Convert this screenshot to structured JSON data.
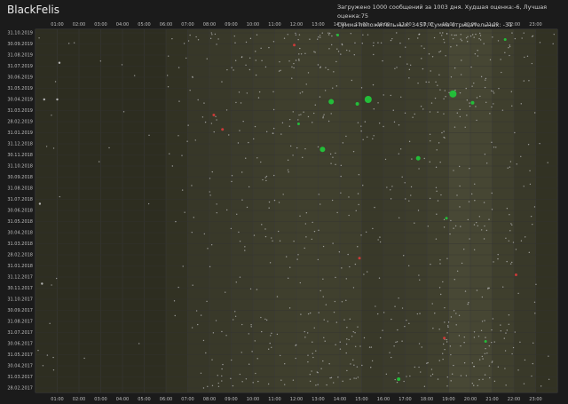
{
  "user": {
    "name": "BlackFelis"
  },
  "stats": {
    "line1": "Загружено 1000 сообщений за 1003 дня. Худшая оценка:-6, Лучшая оценка:75",
    "line2": "Сумма положительных: 3457, Сумма отрицательных: -31"
  },
  "colors": {
    "background": "#1b1b1b",
    "neutral": "#bdbdbd",
    "positive": "#22c43a",
    "negative": "#d23a3a"
  },
  "chart_data": {
    "type": "scatter",
    "title": "",
    "xlabel": "",
    "ylabel": "",
    "x_ticks": [
      "01:00",
      "02:00",
      "03:00",
      "04:00",
      "05:00",
      "06:00",
      "07:00",
      "08:00",
      "09:00",
      "10:00",
      "11:00",
      "12:00",
      "13:00",
      "14:00",
      "15:00",
      "16:00",
      "17:00",
      "18:00",
      "19:00",
      "20:00",
      "21:00",
      "22:00",
      "23:00"
    ],
    "y_ticks": [
      "31.10.2019",
      "30.09.2019",
      "31.08.2019",
      "31.07.2019",
      "30.06.2019",
      "31.05.2019",
      "30.04.2019",
      "31.03.2019",
      "28.02.2019",
      "31.01.2019",
      "31.12.2018",
      "30.11.2018",
      "31.10.2018",
      "30.09.2018",
      "31.08.2018",
      "31.07.2018",
      "30.06.2018",
      "31.05.2018",
      "30.04.2018",
      "31.03.2018",
      "28.02.2018",
      "31.01.2018",
      "31.12.2017",
      "30.11.2017",
      "31.10.2017",
      "30.09.2017",
      "31.08.2017",
      "31.07.2017",
      "30.06.2017",
      "31.05.2017",
      "30.04.2017",
      "31.03.2017",
      "28.02.2017"
    ],
    "xlim": [
      0,
      24
    ],
    "hour_activity": [
      0.05,
      0.03,
      0.02,
      0.02,
      0.02,
      0.03,
      0.15,
      0.3,
      0.35,
      0.4,
      0.45,
      0.5,
      0.55,
      0.55,
      0.5,
      0.35,
      0.4,
      0.45,
      0.55,
      0.75,
      0.7,
      0.5,
      0.35,
      0.15
    ],
    "points": [
      {
        "h": 13.6,
        "m": 6.2,
        "r": "pos",
        "s": 3
      },
      {
        "h": 15.3,
        "m": 6.0,
        "r": "pos",
        "s": 4
      },
      {
        "h": 19.2,
        "m": 5.5,
        "r": "pos",
        "s": 4
      },
      {
        "h": 13.2,
        "m": 10.5,
        "r": "pos",
        "s": 3
      },
      {
        "h": 17.6,
        "m": 11.3,
        "r": "pos",
        "s": 2.5
      },
      {
        "h": 14.8,
        "m": 6.4,
        "r": "pos",
        "s": 2
      },
      {
        "h": 20.1,
        "m": 6.3,
        "r": "pos",
        "s": 2
      },
      {
        "h": 12.1,
        "m": 8.2,
        "r": "pos",
        "s": 1.5
      },
      {
        "h": 16.7,
        "m": 31.2,
        "r": "pos",
        "s": 2
      },
      {
        "h": 13.9,
        "m": 0.2,
        "r": "pos",
        "s": 1.5
      },
      {
        "h": 21.6,
        "m": 0.6,
        "r": "pos",
        "s": 1.5
      },
      {
        "h": 18.9,
        "m": 16.7,
        "r": "pos",
        "s": 1.5
      },
      {
        "h": 20.7,
        "m": 27.8,
        "r": "pos",
        "s": 1.5
      },
      {
        "h": 11.9,
        "m": 1.1,
        "r": "neg",
        "s": 1.5
      },
      {
        "h": 8.2,
        "m": 7.4,
        "r": "neg",
        "s": 1.5
      },
      {
        "h": 8.6,
        "m": 8.7,
        "r": "neg",
        "s": 1.5
      },
      {
        "h": 18.8,
        "m": 27.5,
        "r": "neg",
        "s": 1.5
      },
      {
        "h": 14.9,
        "m": 20.3,
        "r": "neg",
        "s": 1.5
      },
      {
        "h": 22.1,
        "m": 21.8,
        "r": "neg",
        "s": 1.5
      },
      {
        "h": 1.1,
        "m": 2.7,
        "r": "neu",
        "s": 1.2
      },
      {
        "h": 0.4,
        "m": 6.0,
        "r": "neu",
        "s": 1.2
      },
      {
        "h": 1.0,
        "m": 6.0,
        "r": "neu",
        "s": 1.2
      },
      {
        "h": 0.2,
        "m": 15.4,
        "r": "neu",
        "s": 1.2
      },
      {
        "h": 0.3,
        "m": 22.6,
        "r": "neu",
        "s": 1.2
      }
    ]
  }
}
